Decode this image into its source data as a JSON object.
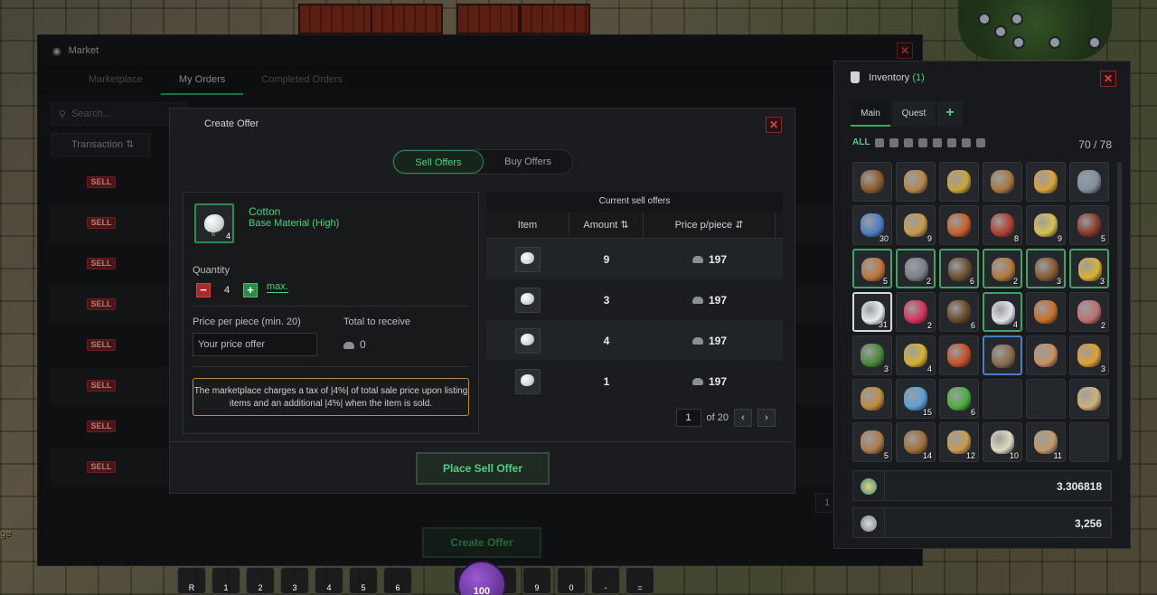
{
  "market": {
    "title": "Market",
    "tabs": [
      "Marketplace",
      "My Orders",
      "Completed Orders"
    ],
    "active_tab": "My Orders",
    "search_placeholder": "Search...",
    "transaction_header": "Transaction",
    "sell_badge": "SELL",
    "create_offer_button": "Create Offer",
    "page_number": "1"
  },
  "create_offer": {
    "title": "Create Offer",
    "tabs": {
      "sell": "Sell Offers",
      "buy": "Buy Offers"
    },
    "item": {
      "name": "Cotton",
      "subtitle": "Base Material (High)",
      "count": "4"
    },
    "quantity_label": "Quantity",
    "quantity_value": "4",
    "max_label": "max.",
    "price_label": "Price per piece (min. 20)",
    "price_placeholder": "Your price offer",
    "total_label": "Total to receive",
    "total_value": "0",
    "tax_notice": "The marketplace charges a tax of |4%| of total sale price upon listing items and an additional |4%| when the item is sold.",
    "place_button": "Place Sell Offer",
    "current_offers": {
      "title": "Current sell offers",
      "columns": {
        "item": "Item",
        "amount": "Amount",
        "price": "Price p/piece"
      },
      "rows": [
        {
          "amount": "9",
          "price": "197"
        },
        {
          "amount": "3",
          "price": "197"
        },
        {
          "amount": "4",
          "price": "197"
        },
        {
          "amount": "1",
          "price": "197"
        }
      ],
      "page": "1",
      "of_pages": "of 20"
    }
  },
  "inventory": {
    "title": "Inventory",
    "title_count": "(1)",
    "tabs": {
      "main": "Main",
      "quest": "Quest"
    },
    "filter_all": "ALL",
    "capacity": "70 / 78",
    "slots": [
      {
        "icon": "bow-icon",
        "count": "",
        "color": "#8b5a2b"
      },
      {
        "icon": "leather-armor-icon",
        "count": "",
        "color": "#b8864a"
      },
      {
        "icon": "chain-necklace-icon",
        "count": "",
        "color": "#c9a53a"
      },
      {
        "icon": "leather-vest-icon",
        "count": "",
        "color": "#a8763c"
      },
      {
        "icon": "gold-ring-icon",
        "count": "",
        "color": "#d9a23a"
      },
      {
        "icon": "ruby-amulet-icon",
        "count": "",
        "color": "#7f8fa0"
      },
      {
        "icon": "blue-wand-icon",
        "count": "30",
        "color": "#4c7fc4"
      },
      {
        "icon": "beer-mug-icon",
        "count": "9",
        "color": "#c89a4a"
      },
      {
        "icon": "copper-bar-icon",
        "count": "",
        "color": "#c8602a"
      },
      {
        "icon": "jam-jar-icon",
        "count": "8",
        "color": "#b04030"
      },
      {
        "icon": "beer-mug-icon",
        "count": "9",
        "color": "#d8c050"
      },
      {
        "icon": "scroll-icon",
        "count": "5",
        "color": "#8a3a2a"
      },
      {
        "icon": "leather-strap-icon",
        "count": "5",
        "color": "#c0743a"
      },
      {
        "icon": "iron-pieces-icon",
        "count": "2",
        "color": "#7a8088"
      },
      {
        "icon": "fur-pelt-icon",
        "count": "6",
        "color": "#6a5030"
      },
      {
        "icon": "seed-icon",
        "count": "2",
        "color": "#b07a3a"
      },
      {
        "icon": "branch-icon",
        "count": "3",
        "color": "#8a5a30"
      },
      {
        "icon": "gold-nuggets-icon",
        "count": "3",
        "color": "#d9b030"
      },
      {
        "icon": "cotton-icon",
        "count": "31",
        "color": "#e8ecee"
      },
      {
        "icon": "red-orb-icon",
        "count": "2",
        "color": "#d8325a"
      },
      {
        "icon": "fish-icon",
        "count": "6",
        "color": "#6a4a2a"
      },
      {
        "icon": "cotton-icon",
        "count": "4",
        "color": "#e0e4e6"
      },
      {
        "icon": "meat-skewer-icon",
        "count": "",
        "color": "#c8702a"
      },
      {
        "icon": "raw-meat-icon",
        "count": "2",
        "color": "#c07070"
      },
      {
        "icon": "herb-plant-icon",
        "count": "3",
        "color": "#4a8a3a"
      },
      {
        "icon": "yellow-potion-icon",
        "count": "4",
        "color": "#d8b030"
      },
      {
        "icon": "crab-icon",
        "count": "",
        "color": "#c8502a"
      },
      {
        "icon": "whip-icon",
        "count": "",
        "color": "#8a6a4a"
      },
      {
        "icon": "mushroom-icon",
        "count": "",
        "color": "#c89060"
      },
      {
        "icon": "fire-orb-icon",
        "count": "3",
        "color": "#e0a030"
      },
      {
        "icon": "leather-pants-icon",
        "count": "",
        "color": "#c08a40"
      },
      {
        "icon": "blue-potion-icon",
        "count": "15",
        "color": "#5aa0d8"
      },
      {
        "icon": "green-potion-icon",
        "count": "6",
        "color": "#4ab040"
      },
      {
        "icon": "empty-slot",
        "count": "",
        "color": ""
      },
      {
        "icon": "empty-slot",
        "count": "",
        "color": ""
      },
      {
        "icon": "wheat-icon",
        "count": "",
        "color": "#d0b07a"
      },
      {
        "icon": "sack-icon",
        "count": "5",
        "color": "#b07a4a"
      },
      {
        "icon": "sack-icon",
        "count": "14",
        "color": "#a0703a"
      },
      {
        "icon": "bread-icon",
        "count": "12",
        "color": "#c89a50"
      },
      {
        "icon": "bone-icon",
        "count": "10",
        "color": "#e0d8c0"
      },
      {
        "icon": "cotton-sack-icon",
        "count": "11",
        "color": "#c09a6a"
      },
      {
        "icon": "empty-slot",
        "count": "",
        "color": ""
      }
    ],
    "currency_gems": "3.306818",
    "currency_coins": "3,256"
  },
  "hud": {
    "hotkeys": [
      "R",
      "1",
      "2",
      "3",
      "4",
      "5",
      "6",
      "7",
      "8",
      "9",
      "0",
      "-",
      "="
    ],
    "orb_value": "100",
    "side_text": "ge"
  },
  "colors": {
    "accent_green": "#4ed07f",
    "sell_red": "#7b1c1c",
    "tax_border": "#c08a3a"
  }
}
